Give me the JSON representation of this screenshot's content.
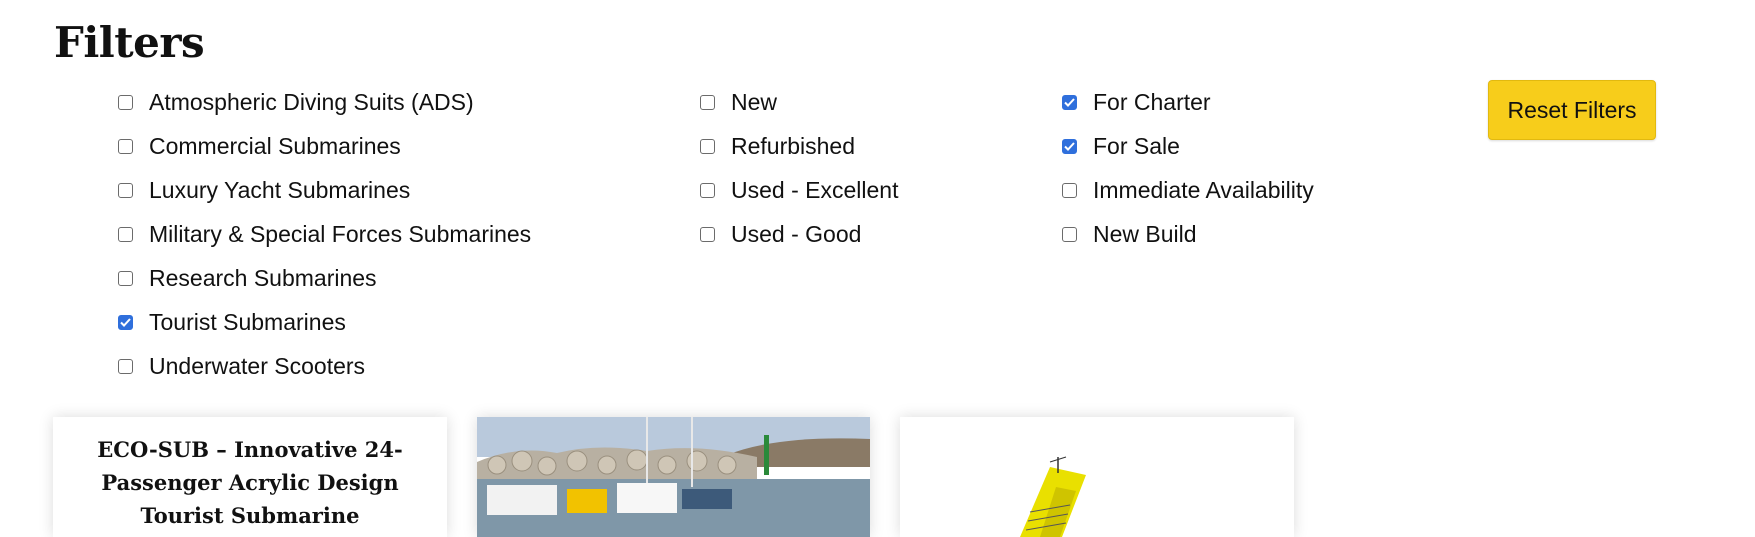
{
  "filters_title": "Filters",
  "reset_label": "Reset Filters",
  "categories": [
    {
      "label": "Atmospheric Diving Suits (ADS)",
      "checked": false
    },
    {
      "label": "Commercial Submarines",
      "checked": false
    },
    {
      "label": "Luxury Yacht Submarines",
      "checked": false
    },
    {
      "label": "Military & Special Forces Submarines",
      "checked": false
    },
    {
      "label": "Research Submarines",
      "checked": false
    },
    {
      "label": "Tourist Submarines",
      "checked": true
    },
    {
      "label": "Underwater Scooters",
      "checked": false
    }
  ],
  "conditions": [
    {
      "label": "New",
      "checked": false
    },
    {
      "label": "Refurbished",
      "checked": false
    },
    {
      "label": "Used - Excellent",
      "checked": false
    },
    {
      "label": "Used - Good",
      "checked": false
    }
  ],
  "availability": [
    {
      "label": "For Charter",
      "checked": true
    },
    {
      "label": "For Sale",
      "checked": true
    },
    {
      "label": "Immediate Availability",
      "checked": false
    },
    {
      "label": "New Build",
      "checked": false
    }
  ],
  "cards": [
    {
      "title": "ECO-SUB – Innovative 24-Passenger Acrylic Design Tourist Submarine"
    }
  ],
  "colors": {
    "accent": "#f7cd1b",
    "checkbox": "#2f6fdc"
  }
}
